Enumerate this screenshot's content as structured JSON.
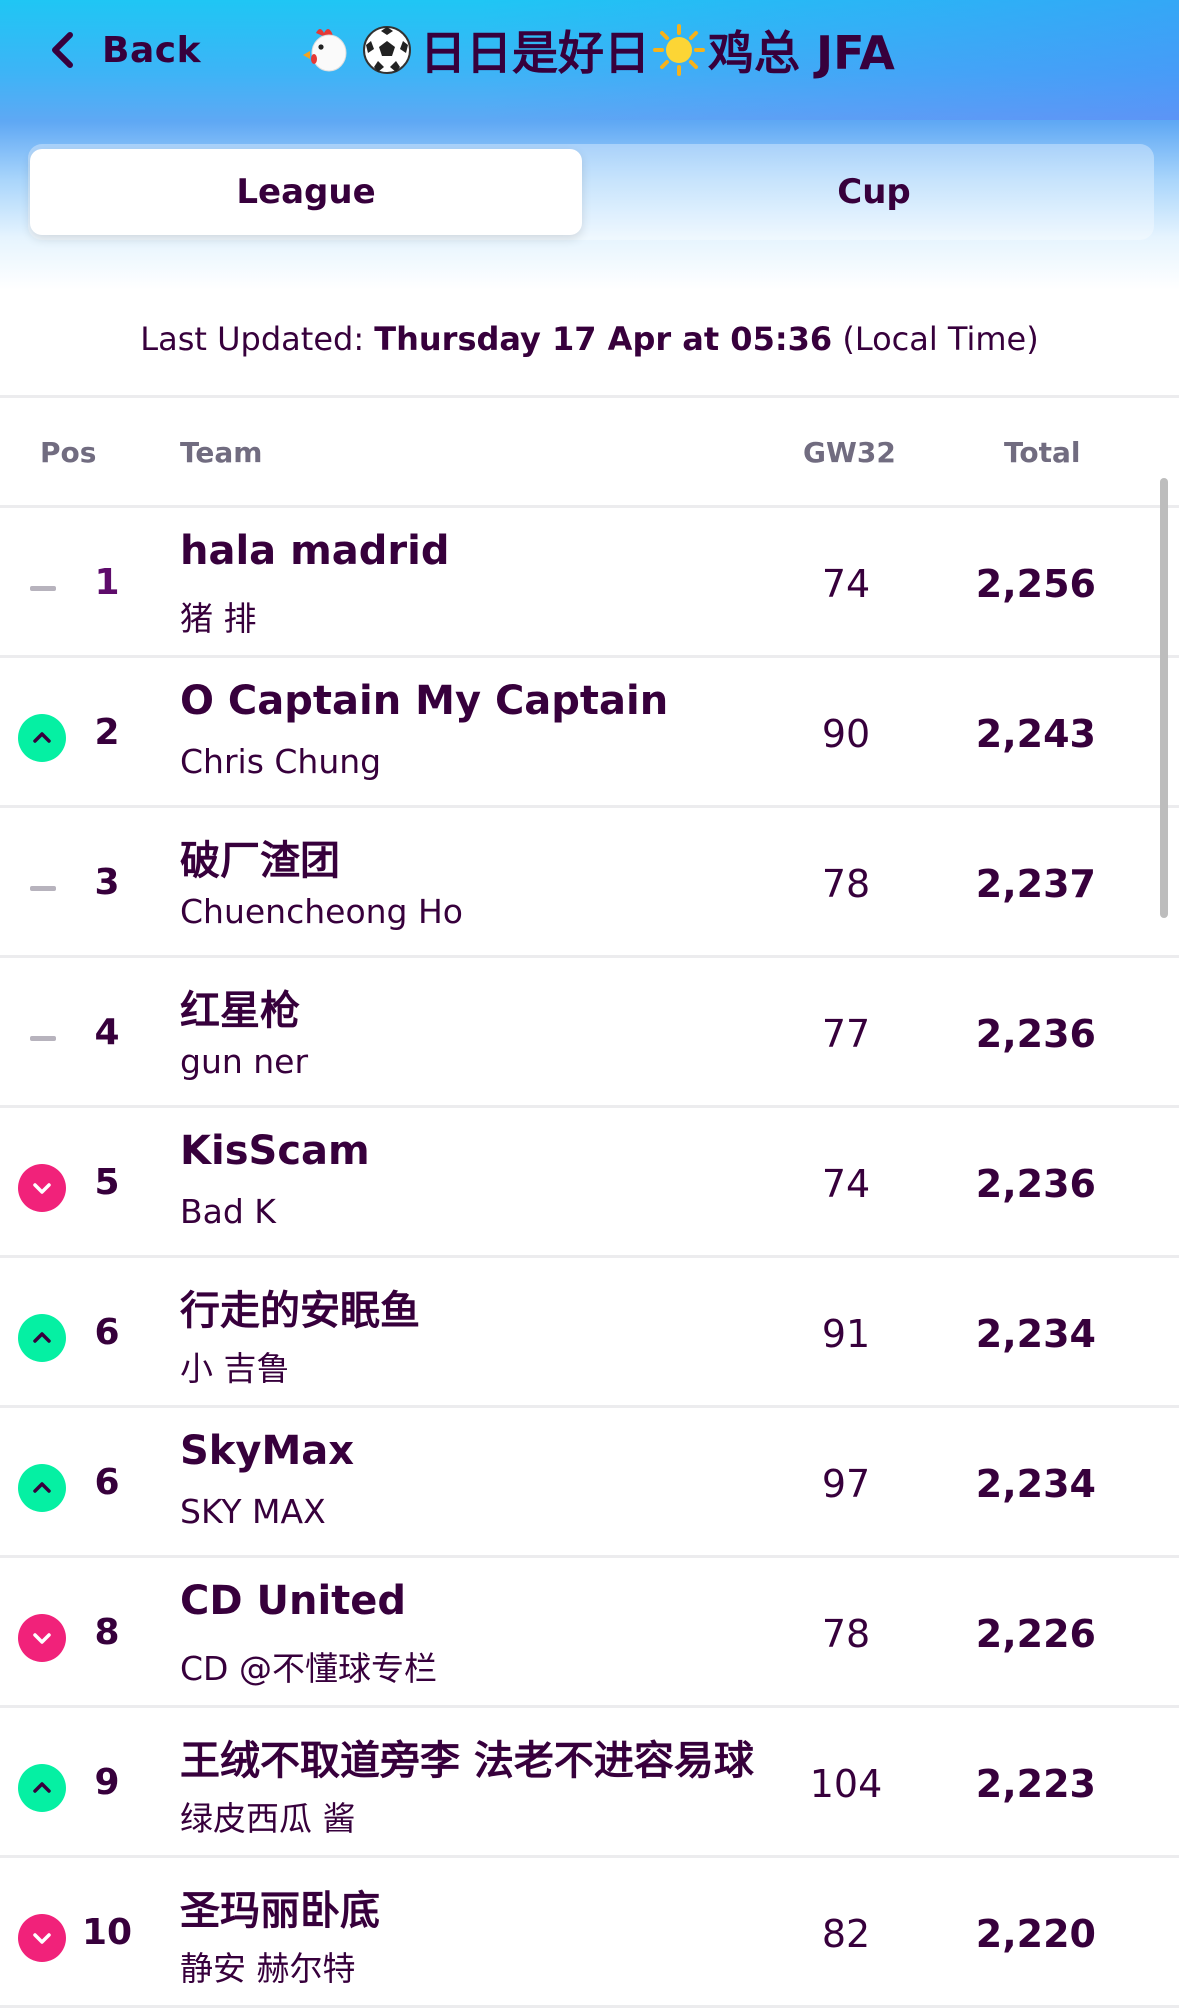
{
  "header": {
    "back_label": "Back",
    "title_name": "日日是好日",
    "title_suffix": "鸡总 JFA"
  },
  "tabs": [
    {
      "label": "League",
      "active": true
    },
    {
      "label": "Cup",
      "active": false
    }
  ],
  "last_updated": {
    "prefix": "Last Updated: ",
    "datetime": "Thursday 17 Apr at 05:36",
    "suffix": " (Local Time)"
  },
  "table": {
    "columns": {
      "pos": "Pos",
      "team": "Team",
      "gw": "GW32",
      "total": "Total"
    },
    "rows": [
      {
        "movement": "same",
        "pos": "1",
        "team": "hala madrid",
        "manager": "猪 排",
        "gw": "74",
        "total": "2,256"
      },
      {
        "movement": "up",
        "pos": "2",
        "team": "O Captain My Captain",
        "manager": "Chris Chung",
        "gw": "90",
        "total": "2,243"
      },
      {
        "movement": "same",
        "pos": "3",
        "team": "破厂渣团",
        "manager": "Chuencheong Ho",
        "gw": "78",
        "total": "2,237"
      },
      {
        "movement": "same",
        "pos": "4",
        "team": "红星枪",
        "manager": "gun ner",
        "gw": "77",
        "total": "2,236"
      },
      {
        "movement": "down",
        "pos": "5",
        "team": "KisScam",
        "manager": "Bad K",
        "gw": "74",
        "total": "2,236"
      },
      {
        "movement": "up",
        "pos": "6",
        "team": "行走的安眠鱼",
        "manager": "小 吉鲁",
        "gw": "91",
        "total": "2,234"
      },
      {
        "movement": "up",
        "pos": "6",
        "team": "SkyMax",
        "manager": "SKY MAX",
        "gw": "97",
        "total": "2,234"
      },
      {
        "movement": "down",
        "pos": "8",
        "team": "CD United",
        "manager": "CD @不懂球专栏",
        "gw": "78",
        "total": "2,226"
      },
      {
        "movement": "up",
        "pos": "9",
        "team": "王绒不取道旁李 法老不进容易球",
        "manager": "绿皮西瓜 酱",
        "gw": "104",
        "total": "2,223"
      },
      {
        "movement": "down",
        "pos": "10",
        "team": "圣玛丽卧底",
        "manager": "静安 赫尔特",
        "gw": "82",
        "total": "2,220"
      }
    ]
  },
  "colors": {
    "brand_purple": "#37003c",
    "up_green": "#05f0a3",
    "down_pink": "#f1227a",
    "header_cyan": "#1fc6f4"
  },
  "icons": [
    "chevron-left-icon",
    "rooster-icon",
    "soccer-ball-icon",
    "sun-icon",
    "movement-up-icon",
    "movement-down-icon",
    "movement-same-icon"
  ]
}
